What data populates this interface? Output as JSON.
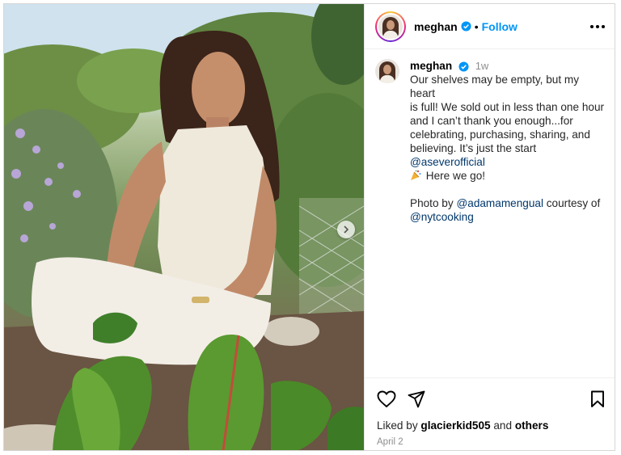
{
  "post": {
    "username": "meghan",
    "follow_label": "Follow",
    "separator": "•",
    "caption": {
      "time": "1w",
      "text_lines": [
        "Our shelves may be empty, but my heart",
        "is full! We sold out in less than one hour",
        "and I can’t thank you enough...for",
        "celebrating, purchasing, sharing, and",
        "believing. It’s just the start"
      ],
      "mention_1": "@aseverofficial",
      "line_after_emoji": "Here we go!",
      "photo_by": "Photo by",
      "mention_2": "@adamamengual",
      "courtesy": "courtesy of",
      "mention_3": "@nytcooking"
    },
    "liked_by_prefix": "Liked by",
    "liked_by_user": "glacierkid505",
    "liked_by_and": "and",
    "liked_by_others": "others",
    "date": "April 2"
  },
  "icons": {
    "verified": "verified-badge-icon",
    "more": "more-options-icon",
    "like": "heart-icon",
    "share": "paper-plane-icon",
    "save": "bookmark-icon",
    "next": "chevron-right-icon",
    "emoji": "party-popper-icon"
  },
  "colors": {
    "follow": "#0095f6",
    "mention": "#00376b",
    "verified": "#0095f6",
    "muted": "#8e8e8e"
  }
}
